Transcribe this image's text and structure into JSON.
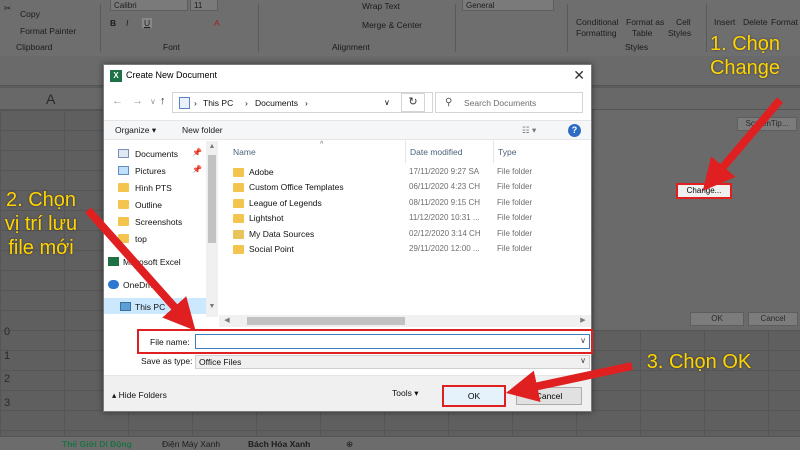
{
  "ribbon": {
    "clipboard": {
      "copy": "Copy",
      "format_painter": "Format Painter",
      "group": "Clipboard"
    },
    "font": {
      "name": "Calibri",
      "size": "11",
      "group": "Font"
    },
    "alignment": {
      "wrap_text": "Wrap Text",
      "merge_center": "Merge & Center",
      "group": "Alignment"
    },
    "number": {
      "format": "General"
    },
    "styles": {
      "conditional": "Conditional",
      "formatting": "Formatting",
      "format_as": "Format as",
      "table": "Table",
      "cell": "Cell",
      "styles_lbl": "Styles",
      "group": "Styles"
    },
    "cells": {
      "insert": "Insert",
      "delete": "Delete",
      "format": "Format"
    }
  },
  "namebox_col": "A",
  "rows": [
    "0",
    "1",
    "2",
    "3"
  ],
  "sheet_tabs": [
    "Thế Giới Di Động",
    "Điện Máy Xanh",
    "Bách Hóa Xanh"
  ],
  "options_dialog": {
    "change_label": "Change...",
    "screentip_label": "ScreenTip...",
    "ok_label": "OK",
    "cancel_label": "Cancel"
  },
  "dialog": {
    "title": "Create New Document",
    "path": [
      "This PC",
      "Documents"
    ],
    "search_placeholder": "Search Documents",
    "organize": "Organize",
    "new_folder": "New folder",
    "tree": [
      {
        "label": "Documents",
        "icon": "documents-icon",
        "pinned": true
      },
      {
        "label": "Pictures",
        "icon": "pictures-icon",
        "pinned": true
      },
      {
        "label": "Hình PTS",
        "icon": "folder-icon",
        "pinned": false
      },
      {
        "label": "Outline",
        "icon": "folder-icon",
        "pinned": false
      },
      {
        "label": "Screenshots",
        "icon": "folder-icon",
        "pinned": false
      },
      {
        "label": "top",
        "icon": "folder-icon",
        "pinned": false
      },
      {
        "label": "Microsoft Excel",
        "icon": "excel-icon",
        "pinned": false
      },
      {
        "label": "OneDrive",
        "icon": "onedrive-icon",
        "pinned": false
      },
      {
        "label": "This PC",
        "icon": "this-pc-icon",
        "pinned": false
      }
    ],
    "columns": {
      "name": "Name",
      "date": "Date modified",
      "type": "Type"
    },
    "files": [
      {
        "name": "Adobe",
        "date": "17/11/2020 9:27 SA",
        "type": "File folder"
      },
      {
        "name": "Custom Office Templates",
        "date": "06/11/2020 4:23 CH",
        "type": "File folder"
      },
      {
        "name": "League of Legends",
        "date": "08/11/2020 9:15 CH",
        "type": "File folder"
      },
      {
        "name": "Lightshot",
        "date": "11/12/2020 10:31 ...",
        "type": "File folder"
      },
      {
        "name": "My Data Sources",
        "date": "02/12/2020 3:14 CH",
        "type": "File folder"
      },
      {
        "name": "Social Point",
        "date": "29/11/2020 12:00 ...",
        "type": "File folder"
      }
    ],
    "file_name_label": "File name:",
    "file_name_value": "",
    "save_type_label": "Save as type:",
    "save_type_value": "Office Files",
    "hide_folders": "Hide Folders",
    "tools": "Tools",
    "ok": "OK",
    "cancel": "Cancel"
  },
  "annotations": {
    "step1": "1. Chọn Change",
    "step2": "2. Chọn vị trí lưu file mới",
    "step3": "3. Chọn OK"
  },
  "colors": {
    "annotation": "#ffd400",
    "highlight": "#e02020",
    "excel_green": "#1e7145"
  }
}
